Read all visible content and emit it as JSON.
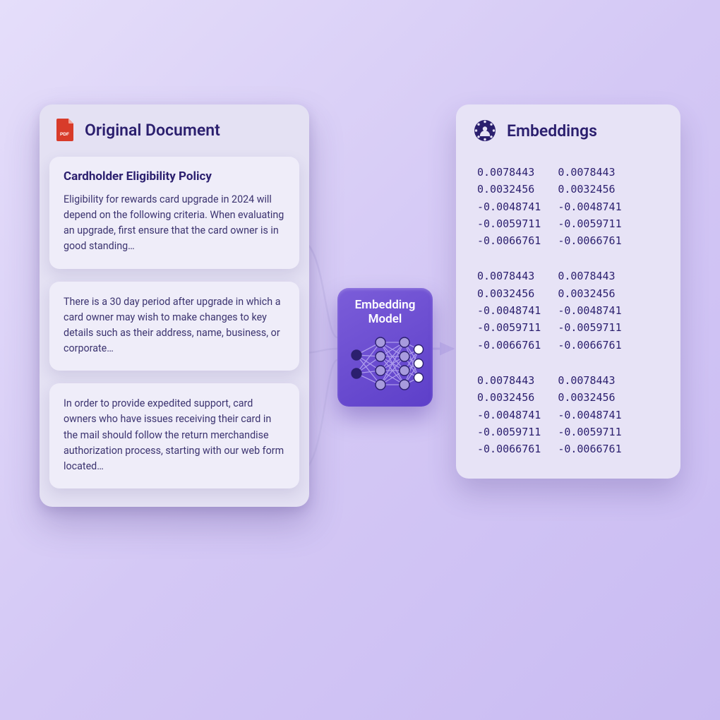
{
  "document": {
    "title": "Original Document",
    "chunks": [
      {
        "heading": "Cardholder Eligibility Policy",
        "body": "Eligibility for rewards card upgrade in 2024 will depend on the following criteria. When evaluating an upgrade, first ensure that the card owner is in good standing…"
      },
      {
        "heading": "",
        "body": "There is a 30 day period after upgrade in which a card owner may wish to make changes to key details such as their address, name, business, or corporate…"
      },
      {
        "heading": "",
        "body": "In order to provide expedited support, card owners who have issues receiving their card in the mail should follow the return merchandise authorization process, starting with our web form located…"
      }
    ]
  },
  "model": {
    "label1": "Embedding",
    "label2": "Model"
  },
  "embeddings": {
    "title": "Embeddings",
    "groups": [
      {
        "col1": [
          "0.0078443",
          "0.0032456",
          "-0.0048741",
          "-0.0059711",
          "-0.0066761"
        ],
        "col2": [
          "0.0078443",
          "0.0032456",
          "-0.0048741",
          "-0.0059711",
          "-0.0066761"
        ]
      },
      {
        "col1": [
          "0.0078443",
          "0.0032456",
          "-0.0048741",
          "-0.0059711",
          "-0.0066761"
        ],
        "col2": [
          "0.0078443",
          "0.0032456",
          "-0.0048741",
          "-0.0059711",
          "-0.0066761"
        ]
      },
      {
        "col1": [
          "0.0078443",
          "0.0032456",
          "-0.0048741",
          "-0.0059711",
          "-0.0066761"
        ],
        "col2": [
          "0.0078443",
          "0.0032456",
          "-0.0048741",
          "-0.0059711",
          "-0.0066761"
        ]
      }
    ]
  },
  "palette": {
    "pdf_red": "#d83b2a",
    "deep": "#2b1f6e",
    "glass": "#efedf9"
  }
}
